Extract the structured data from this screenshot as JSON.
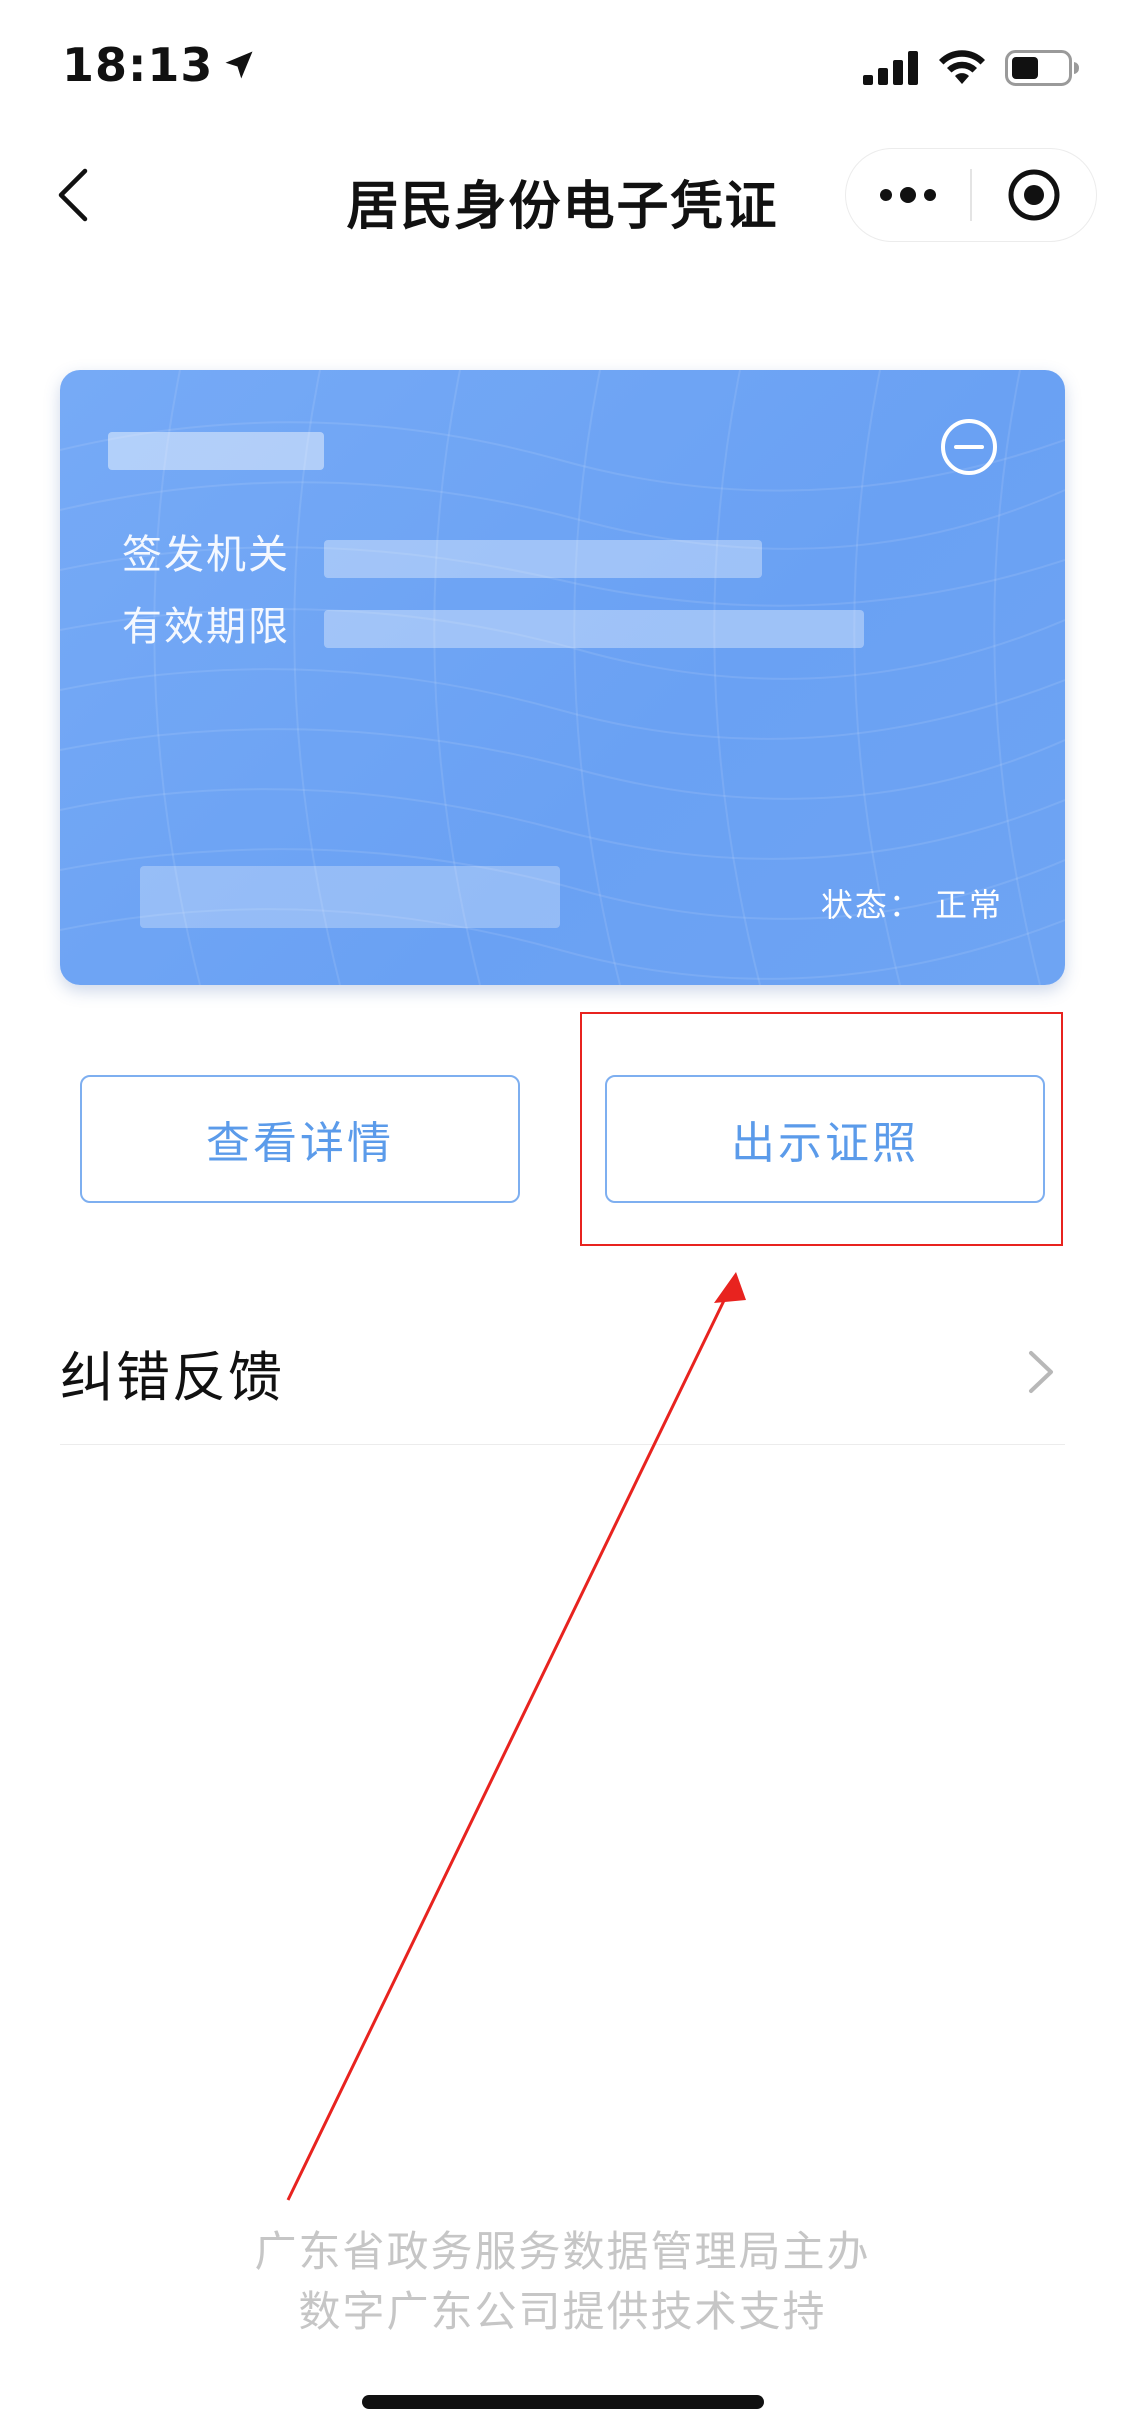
{
  "status_bar": {
    "time": "18:13"
  },
  "nav": {
    "title": "居民身份电子凭证"
  },
  "card": {
    "authority_label": "签发机关",
    "validity_label": "有效期限",
    "status_text": "状态：  正常",
    "colors": {
      "card_bg": "#6ea4f3"
    }
  },
  "actions": {
    "view_details": "查看详情",
    "show_certificate": "出示证照"
  },
  "feedback": {
    "label": "纠错反馈"
  },
  "footer": {
    "line1": "广东省政务服务数据管理局主办",
    "line2": "数字广东公司提供技术支持"
  },
  "annotation": {
    "highlight_color": "#e8231f"
  }
}
